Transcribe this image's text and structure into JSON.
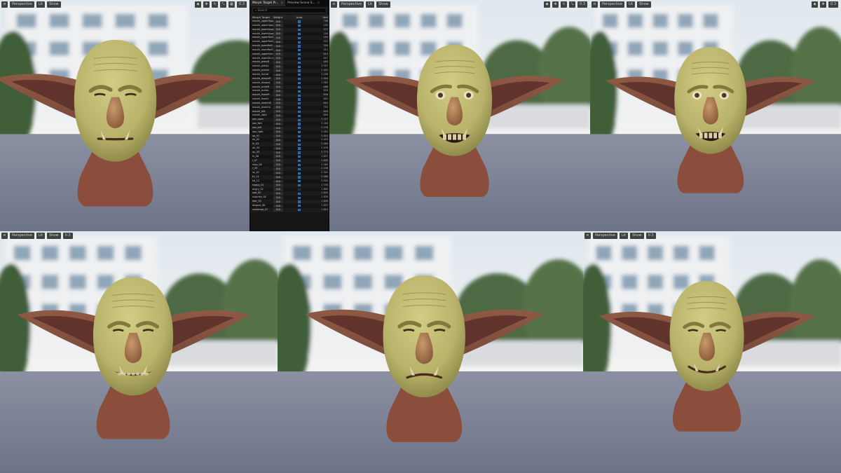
{
  "viewports": [
    {
      "id": "vp1",
      "toolbar": {
        "buttons": [
          "Perspective",
          "Lit",
          "Show"
        ]
      },
      "toolbar_right": {
        "labels": [
          "0.3"
        ]
      },
      "expression": "neutral"
    },
    {
      "id": "vp2",
      "toolbar": {
        "buttons": [
          "Perspective",
          "Lit",
          "Show"
        ]
      },
      "toolbar_right": {
        "labels": [
          "0.3"
        ]
      },
      "expression": "snarl"
    },
    {
      "id": "vp3",
      "toolbar": {
        "buttons": [
          "Perspective",
          "Lit",
          "Show"
        ]
      },
      "toolbar_right": {
        "labels": [
          "0.3"
        ]
      },
      "expression": "snarl"
    },
    {
      "id": "vp4",
      "toolbar": {
        "buttons": [
          "Perspective",
          "Lit",
          "Show"
        ]
      },
      "toolbar_right": {
        "labels": [
          "0.3"
        ]
      },
      "expression": "grin"
    },
    {
      "id": "vp5",
      "stats": [
        "",
        "",
        "",
        "",
        ""
      ],
      "expression": "frown"
    },
    {
      "id": "vp6",
      "toolbar": {
        "buttons": [
          "Perspective",
          "Lit",
          "Show"
        ]
      },
      "toolbar_right": {
        "labels": [
          "0.3"
        ]
      },
      "expression": "smile"
    }
  ],
  "panel": {
    "tabs": [
      {
        "label": "Morph Target Pr...",
        "close": "×"
      },
      {
        "label": "Preview Scene S...",
        "close": "×"
      }
    ],
    "search_placeholder": "Search",
    "headers": {
      "name": "Morph Target Nar",
      "weight": "Weight",
      "auto": "Auto",
      "verts": "Vert Count"
    },
    "morph_targets": [
      {
        "name": "mouth_upperUpper_",
        "weight": "0.0",
        "checked": true,
        "verts": "748"
      },
      {
        "name": "mouth_upperUpper_",
        "weight": "0.0",
        "checked": true,
        "verts": "230"
      },
      {
        "name": "mouth_lowerUpper_",
        "weight": "0.0",
        "checked": true,
        "verts": "372"
      },
      {
        "name": "mouth_lowerUpper_",
        "weight": "0.0",
        "checked": true,
        "verts": "218"
      },
      {
        "name": "mouth_upperRollI",
        "weight": "0.0",
        "checked": true,
        "verts": "245"
      },
      {
        "name": "mouth_upperRollO",
        "weight": "0.0",
        "checked": true,
        "verts": "322"
      },
      {
        "name": "mouth_lowerRollI",
        "weight": "0.0",
        "checked": true,
        "verts": "390"
      },
      {
        "name": "mouth_lowerRollO",
        "weight": "0.0",
        "checked": true,
        "verts": "312"
      },
      {
        "name": "mouth_upperShrug",
        "weight": "0.0",
        "checked": true,
        "verts": "619"
      },
      {
        "name": "mouth_lowerShrug",
        "weight": "0.0",
        "checked": true,
        "verts": "447"
      },
      {
        "name": "mouth_pressR",
        "weight": "0.0",
        "checked": true,
        "verts": "463"
      },
      {
        "name": "mouth_pressL",
        "weight": "0.0",
        "checked": true,
        "verts": "1 097"
      },
      {
        "name": "mouth_pucker",
        "weight": "0.0",
        "checked": true,
        "verts": "1 351"
      },
      {
        "name": "mouth_funnel",
        "weight": "0.0",
        "checked": true,
        "verts": "1 258"
      },
      {
        "name": "mouth_dimpleR",
        "weight": "0.0",
        "checked": true,
        "verts": "1 004"
      },
      {
        "name": "mouth_dimpleL",
        "weight": "0.0",
        "checked": true,
        "verts": "1 062"
      },
      {
        "name": "mouth_smileR",
        "weight": "0.0",
        "checked": true,
        "verts": "486"
      },
      {
        "name": "mouth_smileL",
        "weight": "0.0",
        "checked": true,
        "verts": "816"
      },
      {
        "name": "mouth_frownR",
        "weight": "0.0",
        "checked": true,
        "verts": "838"
      },
      {
        "name": "mouth_frownL",
        "weight": "0.0",
        "checked": true,
        "verts": "892"
      },
      {
        "name": "mouth_stretchR",
        "weight": "0.0",
        "checked": true,
        "verts": "842"
      },
      {
        "name": "mouth_stretchL",
        "weight": "0.0",
        "checked": true,
        "verts": "752"
      },
      {
        "name": "mouth_left",
        "weight": "0.0",
        "checked": true,
        "verts": "829"
      },
      {
        "name": "mouth_right",
        "weight": "0.0",
        "checked": true,
        "verts": "894"
      },
      {
        "name": "jaw_open",
        "weight": "0.0",
        "checked": true,
        "verts": "2 107"
      },
      {
        "name": "jaw_fwd",
        "weight": "0.0",
        "checked": true,
        "verts": "3 184"
      },
      {
        "name": "jaw_left",
        "weight": "0.0",
        "checked": true,
        "verts": "2 078"
      },
      {
        "name": "jaw_right",
        "weight": "0.0",
        "checked": true,
        "verts": "2 052"
      },
      {
        "name": "aa_01",
        "weight": "0.0",
        "checked": true,
        "verts": "2 403"
      },
      {
        "name": "ee_02",
        "weight": "0.0",
        "checked": true,
        "verts": "2 453"
      },
      {
        "name": "ih_03",
        "weight": "0.0",
        "checked": true,
        "verts": "2 060"
      },
      {
        "name": "oh_04",
        "weight": "0.0",
        "checked": true,
        "verts": "2 476"
      },
      {
        "name": "ou_05",
        "weight": "0.0",
        "checked": true,
        "verts": "2 773"
      },
      {
        "name": "fv_06",
        "weight": "0.0",
        "checked": true,
        "verts": "1 637"
      },
      {
        "name": "l_07",
        "weight": "0.0",
        "checked": true,
        "verts": "1 805"
      },
      {
        "name": "mbp_08",
        "weight": "0.0",
        "checked": true,
        "verts": "2 282"
      },
      {
        "name": "r_09",
        "weight": "0.0",
        "checked": true,
        "verts": "2 036"
      },
      {
        "name": "sz_10",
        "weight": "0.0",
        "checked": true,
        "verts": "2 342"
      },
      {
        "name": "th_11",
        "weight": "0.0",
        "checked": true,
        "verts": "2 080"
      },
      {
        "name": "kd_12",
        "weight": "0.0",
        "checked": true,
        "verts": "2 042"
      },
      {
        "name": "happy_01",
        "weight": "0.0",
        "checked": true,
        "verts": "1 735"
      },
      {
        "name": "angry_02",
        "weight": "1.0",
        "checked": false,
        "verts": "1 665"
      },
      {
        "name": "sad_03",
        "weight": "0.0",
        "checked": true,
        "verts": "1 832"
      },
      {
        "name": "surprise_04",
        "weight": "0.0",
        "checked": true,
        "verts": "1 839"
      },
      {
        "name": "fear_05",
        "weight": "0.0",
        "checked": true,
        "verts": "1 805"
      },
      {
        "name": "disgust_06",
        "weight": "0.0",
        "checked": true,
        "verts": "1 837"
      },
      {
        "name": "contempt_07",
        "weight": "0.0",
        "checked": true,
        "verts": "1 810"
      }
    ]
  },
  "colors": {
    "sky_top": "#dfe8ef",
    "sky_bottom": "#f3f3f1",
    "building": "#eef0f2",
    "window": "#6f8da6",
    "tree": "#3f5e37",
    "floor": "#6e7488",
    "skin": "#b8b26a",
    "skin_shadow": "#7d7a3c",
    "ear": "#7a4a3a",
    "ear_inner": "#5a2e2a",
    "neck": "#8c4e3c",
    "panel_bg": "#151515",
    "accent": "#1c5ea8"
  }
}
